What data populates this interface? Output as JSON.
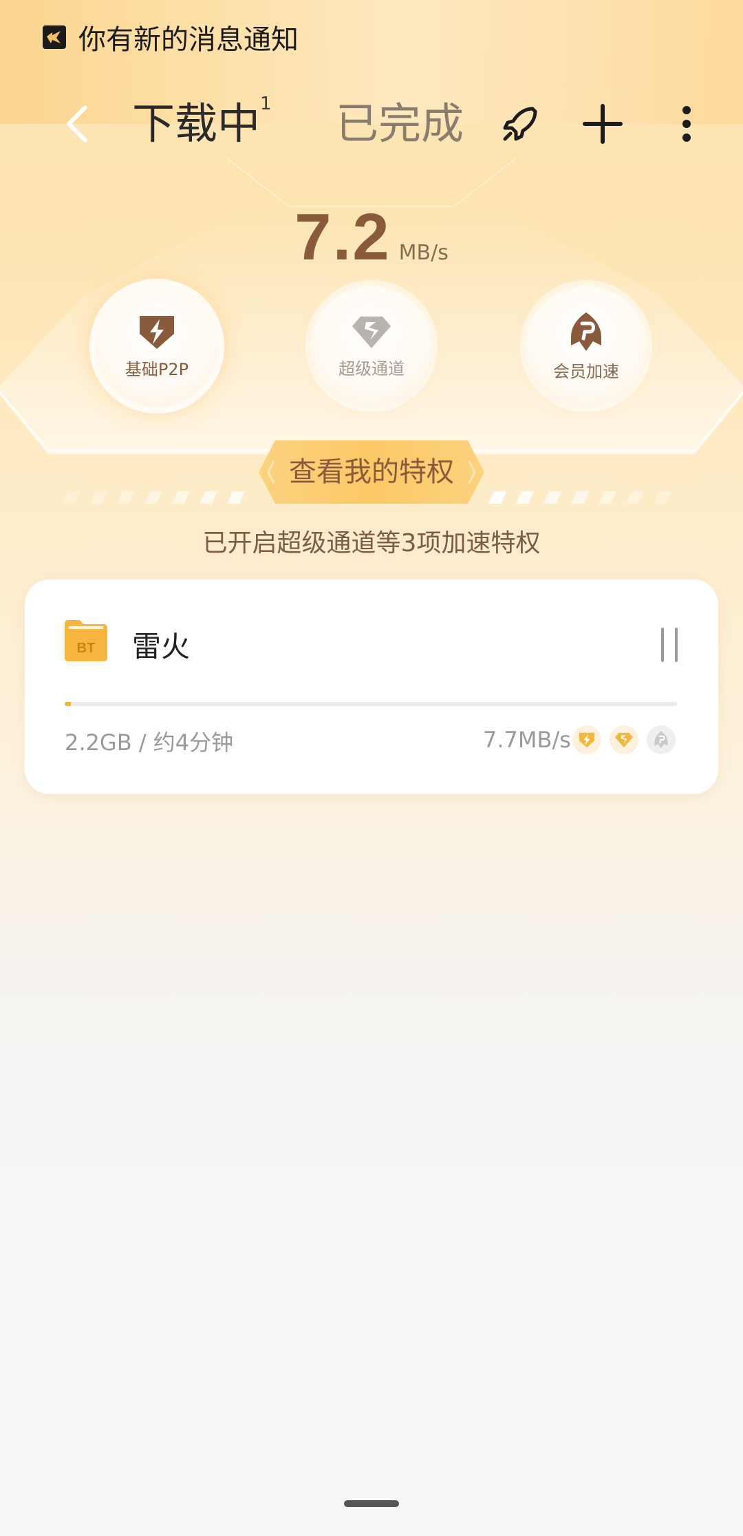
{
  "status_bar": {
    "notification_text": "你有新的消息通知"
  },
  "header": {
    "tabs": [
      {
        "label": "下载中",
        "badge": "1",
        "active": true
      },
      {
        "label": "已完成",
        "active": false
      }
    ],
    "icons": [
      "back-arrow-icon",
      "rocket-icon",
      "plus-icon",
      "more-vertical-icon"
    ]
  },
  "speed": {
    "value": "7.2",
    "unit": "MB/s"
  },
  "accelerators": [
    {
      "label": "基础P2P",
      "icon": "lightning-shield-icon",
      "active": true
    },
    {
      "label": "超级通道",
      "icon": "diamond-icon",
      "active": false
    },
    {
      "label": "会员加速",
      "icon": "vip-rocket-icon",
      "active": false
    }
  ],
  "privilege_button": {
    "label": "查看我的特权"
  },
  "privilege_summary": "已开启超级通道等3项加速特权",
  "task": {
    "name": "雷火",
    "type_badge": "BT",
    "meta": "2.2GB / 约4分钟",
    "speed": "7.7MB/s",
    "progress": 0.01
  },
  "colors": {
    "accent_brown": "#8a5a3c",
    "gold": "#f3b733",
    "background_warm": "#fde4b0"
  }
}
